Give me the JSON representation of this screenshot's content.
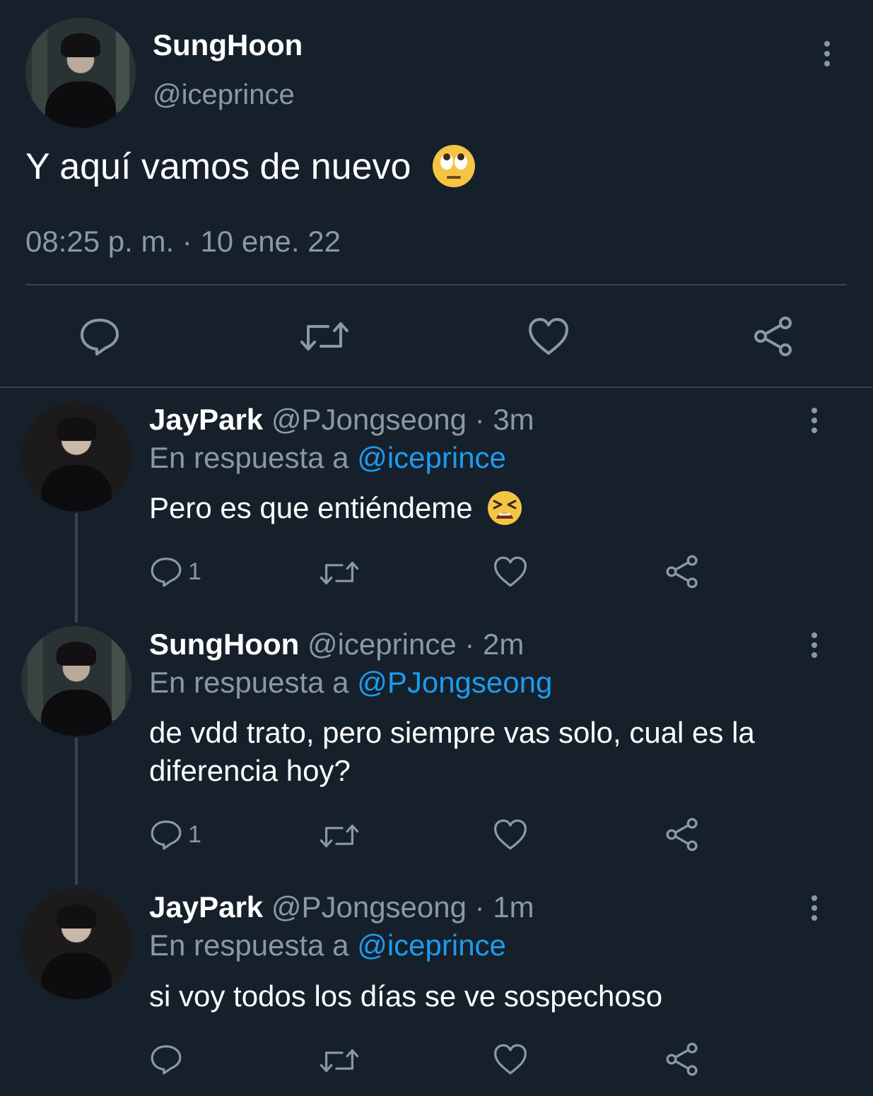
{
  "main_tweet": {
    "name": "SungHoon",
    "handle": "@iceprince",
    "text": "Y aquí vamos de nuevo",
    "emoji": "rolling-eyes-emoji",
    "timestamp": "08:25 p. m. · 10 ene. 22",
    "actions": [
      "reply-icon",
      "retweet-icon",
      "like-icon",
      "share-icon"
    ]
  },
  "replies": [
    {
      "name": "JayPark",
      "handle": "@PJongseong",
      "time": "· 3m",
      "reply_prefix": "En respuesta a",
      "reply_to": "@iceprince",
      "text": "Pero es que entiéndeme",
      "emoji": "tired-face-emoji",
      "reply_count": "1"
    },
    {
      "name": "SungHoon",
      "handle": "@iceprince",
      "time": "· 2m",
      "reply_prefix": "En respuesta a",
      "reply_to": "@PJongseong",
      "text_line1": "de vdd trato, pero siempre vas solo, cual es la",
      "text_line2": "diferencia hoy?",
      "reply_count": "1"
    },
    {
      "name": "JayPark",
      "handle": "@PJongseong",
      "time": "· 1m",
      "reply_prefix": "En respuesta a",
      "reply_to": "@iceprince",
      "text": "si voy todos los días se ve sospechoso",
      "reply_count": ""
    }
  ],
  "colors": {
    "background": "#15202b",
    "text": "#ffffff",
    "muted": "#8b98a5",
    "link": "#1d9bf0",
    "divider": "#38444d"
  }
}
